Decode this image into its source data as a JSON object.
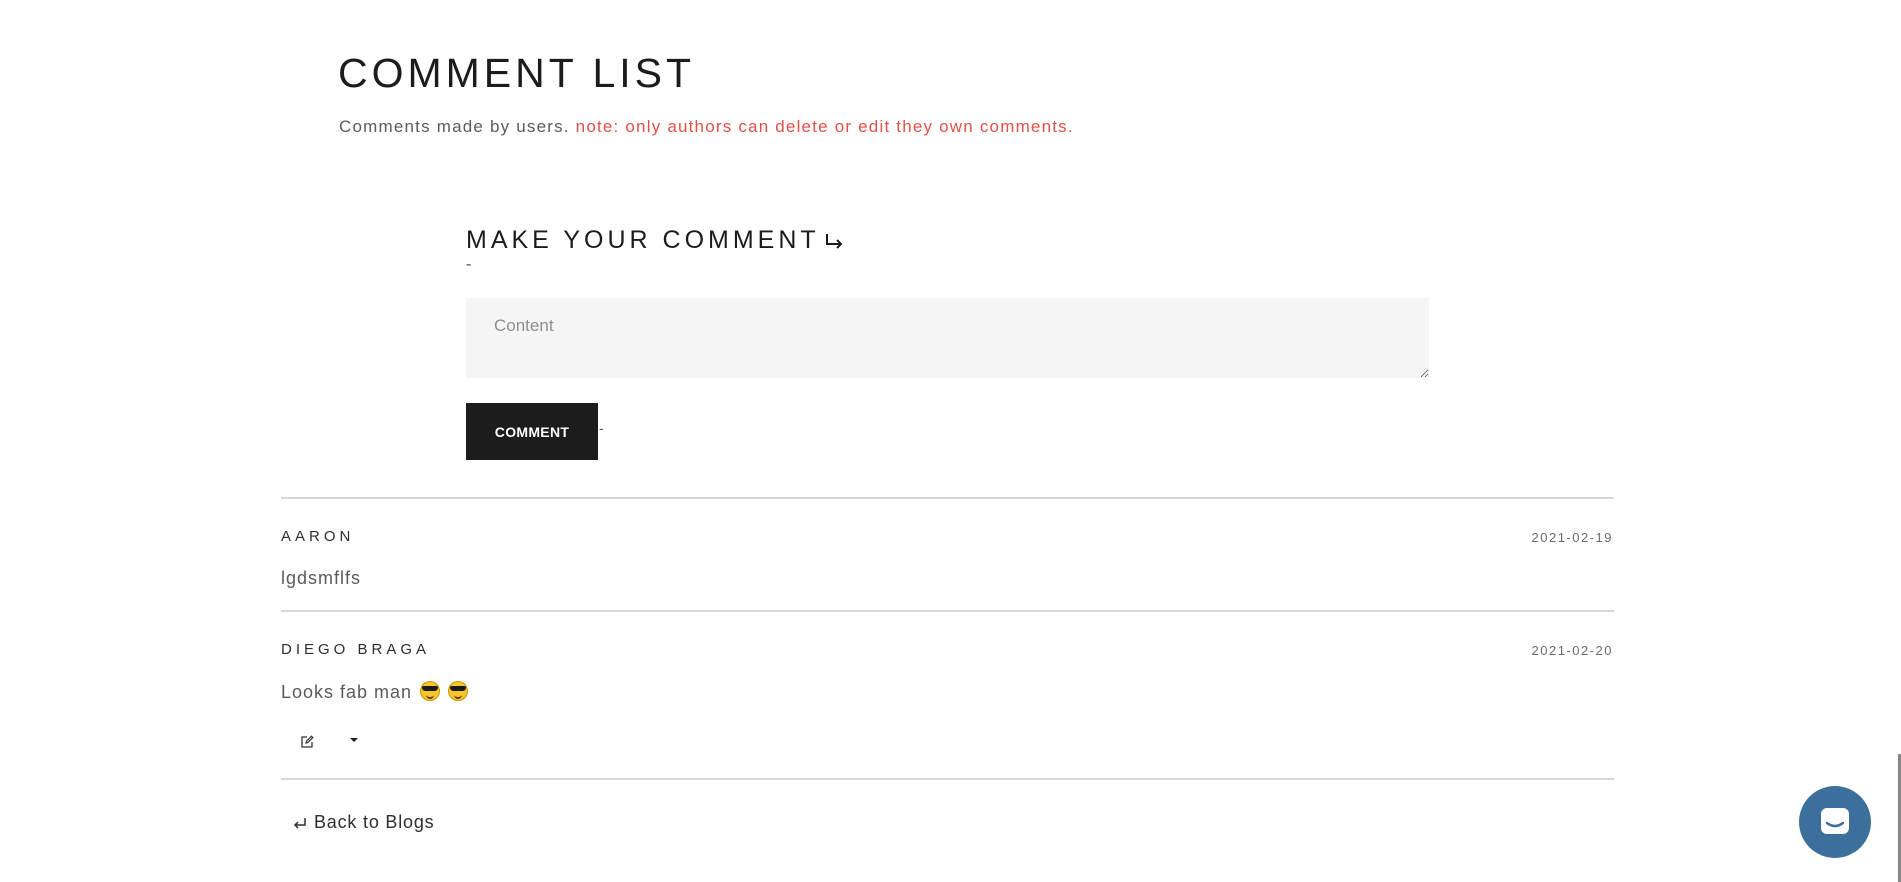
{
  "header": {
    "title": "COMMENT LIST",
    "subtitle": "Comments made by users.",
    "note": "note: only authors can delete or edit they own comments."
  },
  "form": {
    "title": "MAKE YOUR COMMENT",
    "dash": "-",
    "content_placeholder": "Content",
    "content_value": "",
    "submit_label": "COMMENT",
    "submit_dash": "-"
  },
  "comments": [
    {
      "author": "AARON",
      "date": "2021-02-19",
      "text": "lgdsmflfs"
    },
    {
      "author": "DIEGO BRAGA",
      "date": "2021-02-20",
      "text": "Looks fab man",
      "emojis": [
        "smiling-face-with-sunglasses-icon",
        "smiling-face-with-sunglasses-icon"
      ]
    }
  ],
  "footer": {
    "back_label": "Back to Blogs"
  },
  "colors": {
    "note": "#e05248",
    "button_bg": "#1c1c1c",
    "field_bg": "#f5f5f6",
    "chat_button": "#3c6f9c"
  }
}
